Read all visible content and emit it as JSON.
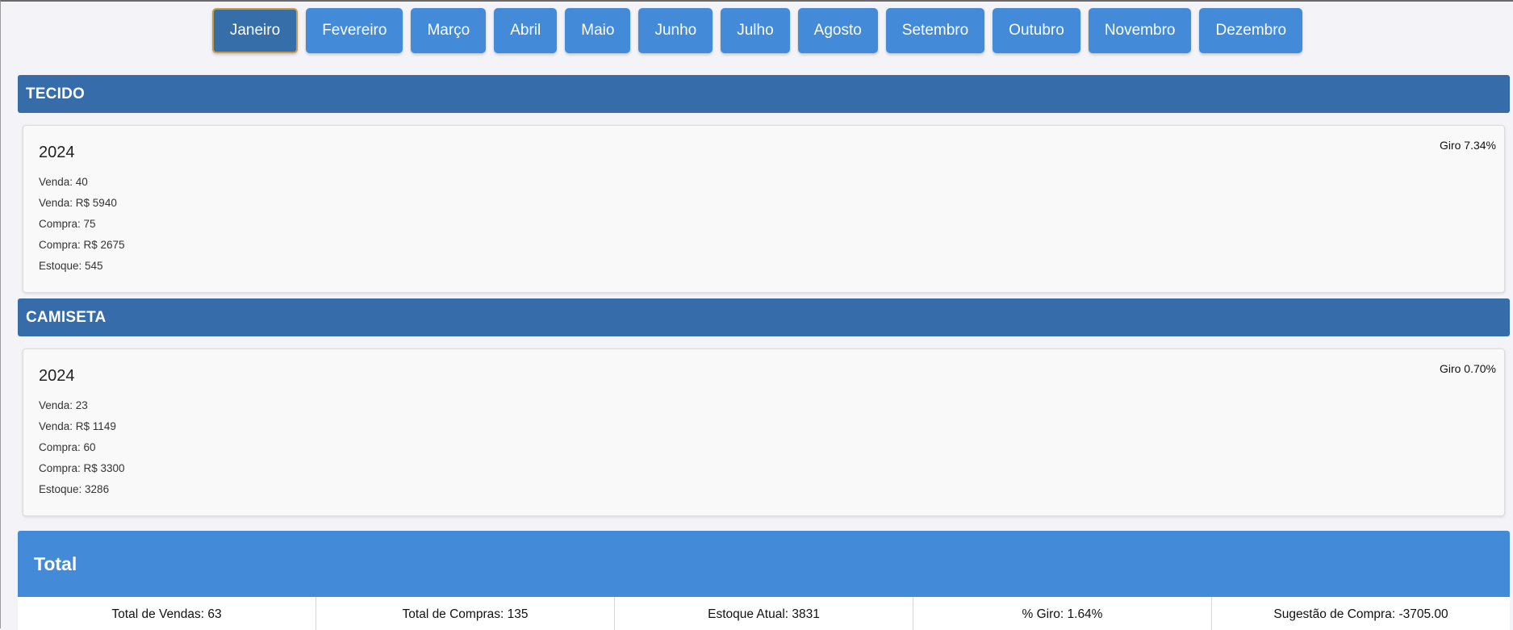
{
  "months": [
    {
      "label": "Janeiro",
      "active": true
    },
    {
      "label": "Fevereiro",
      "active": false
    },
    {
      "label": "Março",
      "active": false
    },
    {
      "label": "Abril",
      "active": false
    },
    {
      "label": "Maio",
      "active": false
    },
    {
      "label": "Junho",
      "active": false
    },
    {
      "label": "Julho",
      "active": false
    },
    {
      "label": "Agosto",
      "active": false
    },
    {
      "label": "Setembro",
      "active": false
    },
    {
      "label": "Outubro",
      "active": false
    },
    {
      "label": "Novembro",
      "active": false
    },
    {
      "label": "Dezembro",
      "active": false
    }
  ],
  "sections": [
    {
      "title": "TECIDO",
      "year": "2024",
      "giro": "Giro 7.34%",
      "stats": [
        "Venda: 40",
        "Venda: R$ 5940",
        "Compra: 75",
        "Compra: R$ 2675",
        "Estoque: 545"
      ]
    },
    {
      "title": "CAMISETA",
      "year": "2024",
      "giro": "Giro 0.70%",
      "stats": [
        "Venda: 23",
        "Venda: R$ 1149",
        "Compra: 60",
        "Compra: R$ 3300",
        "Estoque: 3286"
      ]
    }
  ],
  "total": {
    "title": "Total",
    "cells": [
      "Total de Vendas: 63",
      "Total de Compras: 135",
      "Estoque Atual: 3831",
      "% Giro: 1.64%",
      "Sugestão de Compra: -3705.00"
    ]
  },
  "colors": {
    "month_button": "#438bd9",
    "month_button_active": "#356ea9",
    "section_header": "#356ca9",
    "total_header": "#438bd9"
  }
}
